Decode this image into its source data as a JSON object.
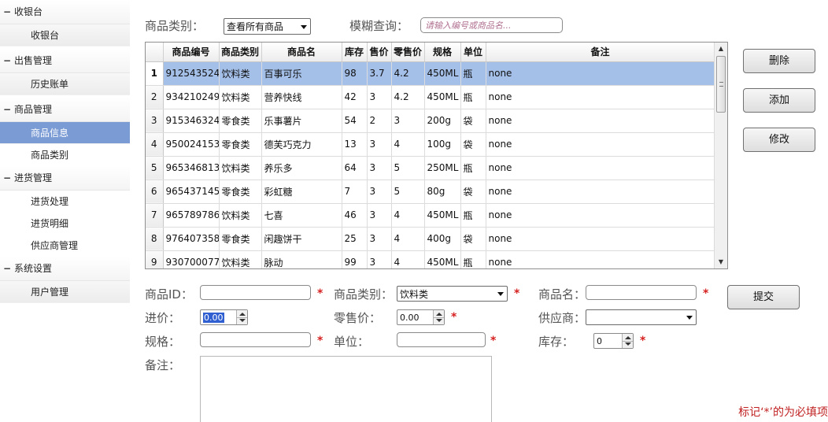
{
  "sidebar": {
    "groups": [
      {
        "label": "收银台",
        "items": [
          {
            "label": "收银台"
          }
        ]
      },
      {
        "label": "出售管理",
        "items": [
          {
            "label": "历史账单"
          }
        ]
      },
      {
        "label": "商品管理",
        "items": [
          {
            "label": "商品信息"
          },
          {
            "label": "商品类别"
          }
        ]
      },
      {
        "label": "进货管理",
        "items": [
          {
            "label": "进货处理"
          },
          {
            "label": "进货明细"
          },
          {
            "label": "供应商管理"
          }
        ]
      },
      {
        "label": "系统设置",
        "items": [
          {
            "label": "用户管理"
          }
        ]
      }
    ],
    "minus": "−",
    "active_item": "商品信息"
  },
  "filter": {
    "category_label": "商品类别：",
    "category_selected": "查看所有商品",
    "search_label": "模糊查询：",
    "search_placeholder": "请输入编号或商品名..."
  },
  "table": {
    "columns": [
      "商品编号",
      "商品类别",
      "商品名",
      "库存",
      "售价",
      "零售价",
      "规格",
      "单位",
      "备注"
    ],
    "rows": [
      {
        "no": "1",
        "id": "912543524",
        "cat": "饮料类",
        "name": "百事可乐",
        "stock": "98",
        "price": "3.7",
        "retail": "4.2",
        "spec": "450ML",
        "unit": "瓶",
        "note": "none"
      },
      {
        "no": "2",
        "id": "934210249",
        "cat": "饮料类",
        "name": "营养快线",
        "stock": "42",
        "price": "3",
        "retail": "4.2",
        "spec": "450ML",
        "unit": "瓶",
        "note": "none"
      },
      {
        "no": "3",
        "id": "915346324",
        "cat": "零食类",
        "name": "乐事薯片",
        "stock": "54",
        "price": "2",
        "retail": "3",
        "spec": "200g",
        "unit": "袋",
        "note": "none"
      },
      {
        "no": "4",
        "id": "950024153",
        "cat": "零食类",
        "name": "德芙巧克力",
        "stock": "13",
        "price": "3",
        "retail": "4",
        "spec": "100g",
        "unit": "袋",
        "note": "none"
      },
      {
        "no": "5",
        "id": "965346813",
        "cat": "饮料类",
        "name": "养乐多",
        "stock": "64",
        "price": "3",
        "retail": "5",
        "spec": "250ML",
        "unit": "瓶",
        "note": "none"
      },
      {
        "no": "6",
        "id": "965437145",
        "cat": "零食类",
        "name": "彩虹糖",
        "stock": "7",
        "price": "3",
        "retail": "5",
        "spec": "80g",
        "unit": "袋",
        "note": "none"
      },
      {
        "no": "7",
        "id": "965789786",
        "cat": "饮料类",
        "name": "七喜",
        "stock": "46",
        "price": "3",
        "retail": "4",
        "spec": "450ML",
        "unit": "瓶",
        "note": "none"
      },
      {
        "no": "8",
        "id": "976407358",
        "cat": "零食类",
        "name": "闲趣饼干",
        "stock": "25",
        "price": "3",
        "retail": "4",
        "spec": "400g",
        "unit": "袋",
        "note": "none"
      },
      {
        "no": "9",
        "id": "930700077",
        "cat": "饮料类",
        "name": "脉动",
        "stock": "99",
        "price": "3",
        "retail": "4",
        "spec": "450ML",
        "unit": "瓶",
        "note": "none"
      }
    ],
    "selected_row": 1
  },
  "buttons": {
    "delete": "删除",
    "add": "添加",
    "edit": "修改",
    "submit": "提交"
  },
  "form": {
    "id_label": "商品ID：",
    "category_label": "商品类别：",
    "category_value": "饮料类",
    "name_label": "商品名：",
    "cost_label": "进价：",
    "cost_value": "0.00",
    "retail_label": "零售价：",
    "retail_value": "0.00",
    "supplier_label": "供应商：",
    "spec_label": "规格：",
    "unit_label": "单位：",
    "stock_label": "库存：",
    "stock_value": "0",
    "note_label": "备注：",
    "required_mark": "*",
    "required_hint": "标记‘*’的为必填项"
  },
  "colors": {
    "selection": "#a4bfe8",
    "active_nav": "#7b9bd4",
    "required": "#d62020"
  }
}
